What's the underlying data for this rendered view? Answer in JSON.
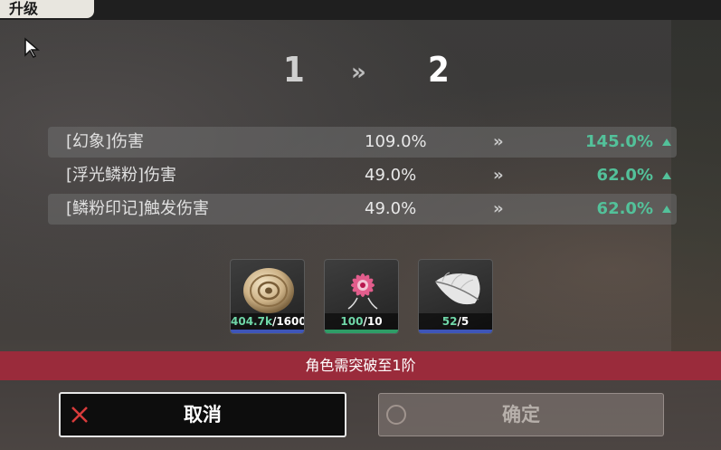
{
  "header": {
    "title": "升级"
  },
  "level": {
    "from": "1",
    "to": "2",
    "arrow": "»"
  },
  "stats": [
    {
      "name": "[幻象]伤害",
      "old": "109.0%",
      "arrow": "»",
      "new": "145.0%"
    },
    {
      "name": "[浮光鳞粉]伤害",
      "old": "49.0%",
      "arrow": "»",
      "new": "62.0%"
    },
    {
      "name": "[鳞粉印记]触发伤害",
      "old": "49.0%",
      "arrow": "»",
      "new": "62.0%"
    }
  ],
  "materials": [
    {
      "icon": "coin-icon",
      "have": "404.7k",
      "need": "/1600",
      "rarity_color": "#3e55b8"
    },
    {
      "icon": "flower-icon",
      "have": "100",
      "need": "/10",
      "rarity_color": "#2e9d66"
    },
    {
      "icon": "feather-icon",
      "have": "52",
      "need": "/5",
      "rarity_color": "#3e55b8"
    }
  ],
  "warning": "角色需突破至1阶",
  "buttons": {
    "cancel": "取消",
    "confirm": "确定"
  },
  "colors": {
    "accent_green": "#53c19a",
    "warning_bg": "#9a2b3b"
  }
}
